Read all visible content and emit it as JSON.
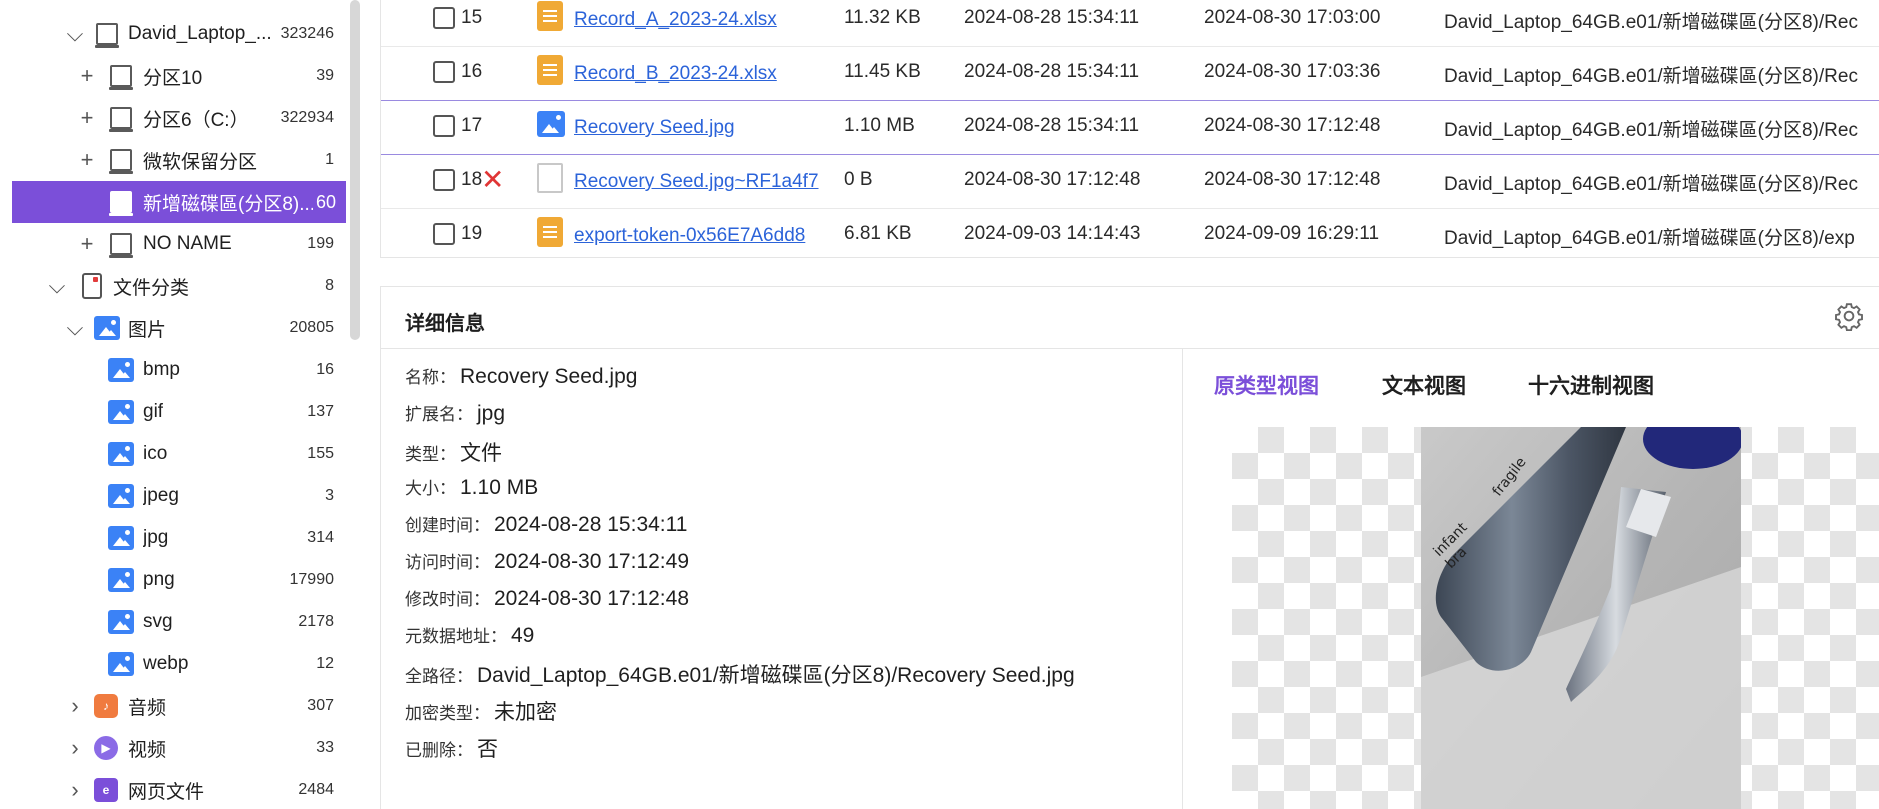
{
  "sidebar": {
    "items": [
      {
        "label": "David_Laptop_...",
        "count": "323246"
      },
      {
        "label": "分区10",
        "count": "39"
      },
      {
        "label": "分区6（C:）",
        "count": "322934"
      },
      {
        "label": "微软保留分区",
        "count": "1"
      },
      {
        "label": "新增磁碟區(分区8)...",
        "count": "60"
      },
      {
        "label": "NO NAME",
        "count": "199"
      },
      {
        "label": "文件分类",
        "count": "8"
      },
      {
        "label": "图片",
        "count": "20805"
      },
      {
        "label": "bmp",
        "count": "16"
      },
      {
        "label": "gif",
        "count": "137"
      },
      {
        "label": "ico",
        "count": "155"
      },
      {
        "label": "jpeg",
        "count": "3"
      },
      {
        "label": "jpg",
        "count": "314"
      },
      {
        "label": "png",
        "count": "17990"
      },
      {
        "label": "svg",
        "count": "2178"
      },
      {
        "label": "webp",
        "count": "12"
      },
      {
        "label": "音频",
        "count": "307"
      },
      {
        "label": "视频",
        "count": "33"
      },
      {
        "label": "网页文件",
        "count": "2484"
      }
    ]
  },
  "files": [
    {
      "num": "15",
      "name": "Record_A_2023-24.xlsx",
      "size": "11.32 KB",
      "created": "2024-08-28 15:34:11",
      "modified": "2024-08-30 17:03:00",
      "path": "David_Laptop_64GB.e01/新增磁碟區(分区8)/Rec"
    },
    {
      "num": "16",
      "name": "Record_B_2023-24.xlsx",
      "size": "11.45 KB",
      "created": "2024-08-28 15:34:11",
      "modified": "2024-08-30 17:03:36",
      "path": "David_Laptop_64GB.e01/新增磁碟區(分区8)/Rec"
    },
    {
      "num": "17",
      "name": "Recovery Seed.jpg",
      "size": "1.10 MB",
      "created": "2024-08-28 15:34:11",
      "modified": "2024-08-30 17:12:48",
      "path": "David_Laptop_64GB.e01/新增磁碟區(分区8)/Rec"
    },
    {
      "num": "18",
      "name": "Recovery Seed.jpg~RF1a4f7",
      "size": "0 B",
      "created": "2024-08-30 17:12:48",
      "modified": "2024-08-30 17:12:48",
      "path": "David_Laptop_64GB.e01/新增磁碟區(分区8)/Rec"
    },
    {
      "num": "19",
      "name": "export-token-0x56E7A6dd8",
      "size": "6.81 KB",
      "created": "2024-09-03 14:14:43",
      "modified": "2024-09-09 16:29:11",
      "path": "David_Laptop_64GB.e01/新增磁碟區(分区8)/exp"
    }
  ],
  "detail": {
    "title": "详细信息",
    "props": [
      {
        "key": "名称：",
        "value": "Recovery Seed.jpg"
      },
      {
        "key": "扩展名：",
        "value": "jpg"
      },
      {
        "key": "类型：",
        "value": "文件"
      },
      {
        "key": "大小：",
        "value": "1.10 MB"
      },
      {
        "key": "创建时间：",
        "value": "2024-08-28 15:34:11"
      },
      {
        "key": "访问时间：",
        "value": "2024-08-30 17:12:49"
      },
      {
        "key": "修改时间：",
        "value": "2024-08-30 17:12:48"
      },
      {
        "key": "元数据地址：",
        "value": "49"
      },
      {
        "key": "全路径：",
        "value": "David_Laptop_64GB.e01/新增磁碟區(分区8)/Recovery Seed.jpg"
      },
      {
        "key": "加密类型：",
        "value": "未加密"
      },
      {
        "key": "已删除：",
        "value": "否"
      }
    ],
    "tabs": [
      "原类型视图",
      "文本视图",
      "十六进制视图"
    ]
  },
  "photo_text": {
    "word1": "fragile",
    "word2": "infant",
    "word3": "bra"
  },
  "colors": {
    "accent": "#7b4fd9",
    "link": "#2b63d9",
    "delete": "#e03535"
  }
}
